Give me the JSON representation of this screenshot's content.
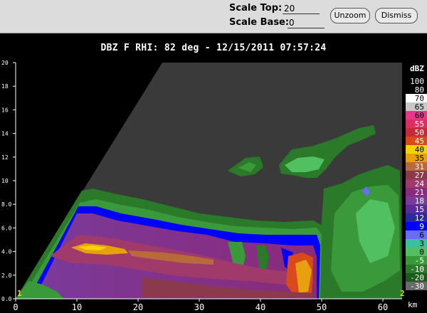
{
  "toolbar": {
    "scale_top_label": "Scale Top:",
    "scale_top_value": "20",
    "scale_base_label": "Scale Base:",
    "scale_base_value": "0",
    "unzoom_label": "Unzoom",
    "dismiss_label": "Dismiss"
  },
  "plot": {
    "title": "DBZ F  RHI: 82 deg  -  12/15/2011 07:57:24",
    "y_ticks": [
      "20",
      "18",
      "16",
      "14",
      "12",
      "10",
      "8.0",
      "6.0",
      "4.0",
      "2.0",
      "0.0"
    ],
    "x_ticks": [
      "0",
      "10",
      "20",
      "30",
      "40",
      "50",
      "60"
    ],
    "x_unit": "km",
    "corner_marker_left": "1",
    "corner_marker_right": "2"
  },
  "colorbar": {
    "unit": "dBZ",
    "entries": [
      {
        "label": "100",
        "color": "#000000"
      },
      {
        "label": "80",
        "color": "#000000"
      },
      {
        "label": "70",
        "color": "#ffffff"
      },
      {
        "label": "65",
        "color": "#c8c8c8"
      },
      {
        "label": "60",
        "color": "#e8368a"
      },
      {
        "label": "55",
        "color": "#d83060"
      },
      {
        "label": "50",
        "color": "#c42a3a"
      },
      {
        "label": "45",
        "color": "#d84a1a"
      },
      {
        "label": "40",
        "color": "#f4d400"
      },
      {
        "label": "35",
        "color": "#e8a010"
      },
      {
        "label": "31",
        "color": "#b86a3a"
      },
      {
        "label": "27",
        "color": "#8a3a4a"
      },
      {
        "label": "24",
        "color": "#a03a6a"
      },
      {
        "label": "21",
        "color": "#8a2a7a"
      },
      {
        "label": "18",
        "color": "#7a3a9a"
      },
      {
        "label": "15",
        "color": "#5a2a9a"
      },
      {
        "label": "12",
        "color": "#2a2a9a"
      },
      {
        "label": "9",
        "color": "#0000ff"
      },
      {
        "label": "6",
        "color": "#6a6aff"
      },
      {
        "label": "3",
        "color": "#3ac0a0"
      },
      {
        "label": "0",
        "color": "#50c060"
      },
      {
        "label": "-5",
        "color": "#3a9a3a"
      },
      {
        "label": "-10",
        "color": "#2a7a2a"
      },
      {
        "label": "-20",
        "color": "#1a5a1a"
      },
      {
        "label": "-30",
        "color": "#6a6a6a"
      }
    ]
  }
}
